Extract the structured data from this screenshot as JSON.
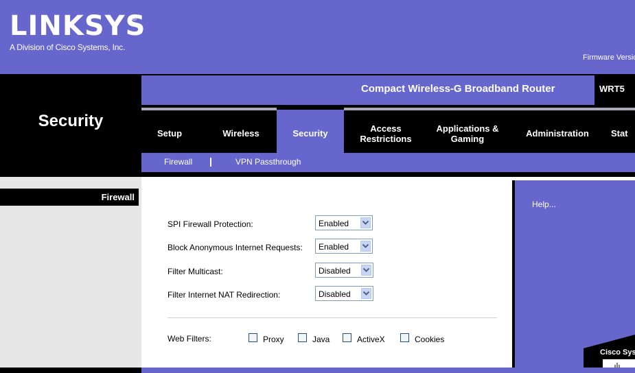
{
  "header": {
    "logo": "LINKSYS",
    "logo_reg": "®",
    "logo_subtitle": "A Division of Cisco Systems, Inc.",
    "firmware_label": "Firmware Version:"
  },
  "product": {
    "name": "Compact Wireless-G Broadband Router",
    "model": "WRT5"
  },
  "section_title": "Security",
  "tabs": [
    {
      "label": "Setup"
    },
    {
      "label": "Wireless"
    },
    {
      "label": "Security"
    },
    {
      "label": "Access Restrictions"
    },
    {
      "label": "Applications & Gaming"
    },
    {
      "label": "Administration"
    },
    {
      "label": "Stat"
    }
  ],
  "subnav": {
    "firewall": "Firewall",
    "vpn": "VPN Passthrough"
  },
  "left_label": "Firewall",
  "help": "Help...",
  "settings": {
    "spi": {
      "label": "SPI Firewall Protection:",
      "value": "Enabled"
    },
    "block": {
      "label": "Block Anonymous Internet Requests:",
      "value": "Enabled"
    },
    "multicast": {
      "label": "Filter Multicast:",
      "value": "Disabled"
    },
    "nat": {
      "label": "Filter Internet NAT Redirection:",
      "value": "Disabled"
    }
  },
  "web_filters": {
    "label": "Web Filters:",
    "options": [
      "Proxy",
      "Java",
      "ActiveX",
      "Cookies"
    ]
  },
  "cisco": "Cisco Syst",
  "colors": {
    "brand_purple": "#6666cc",
    "black": "#000000"
  }
}
